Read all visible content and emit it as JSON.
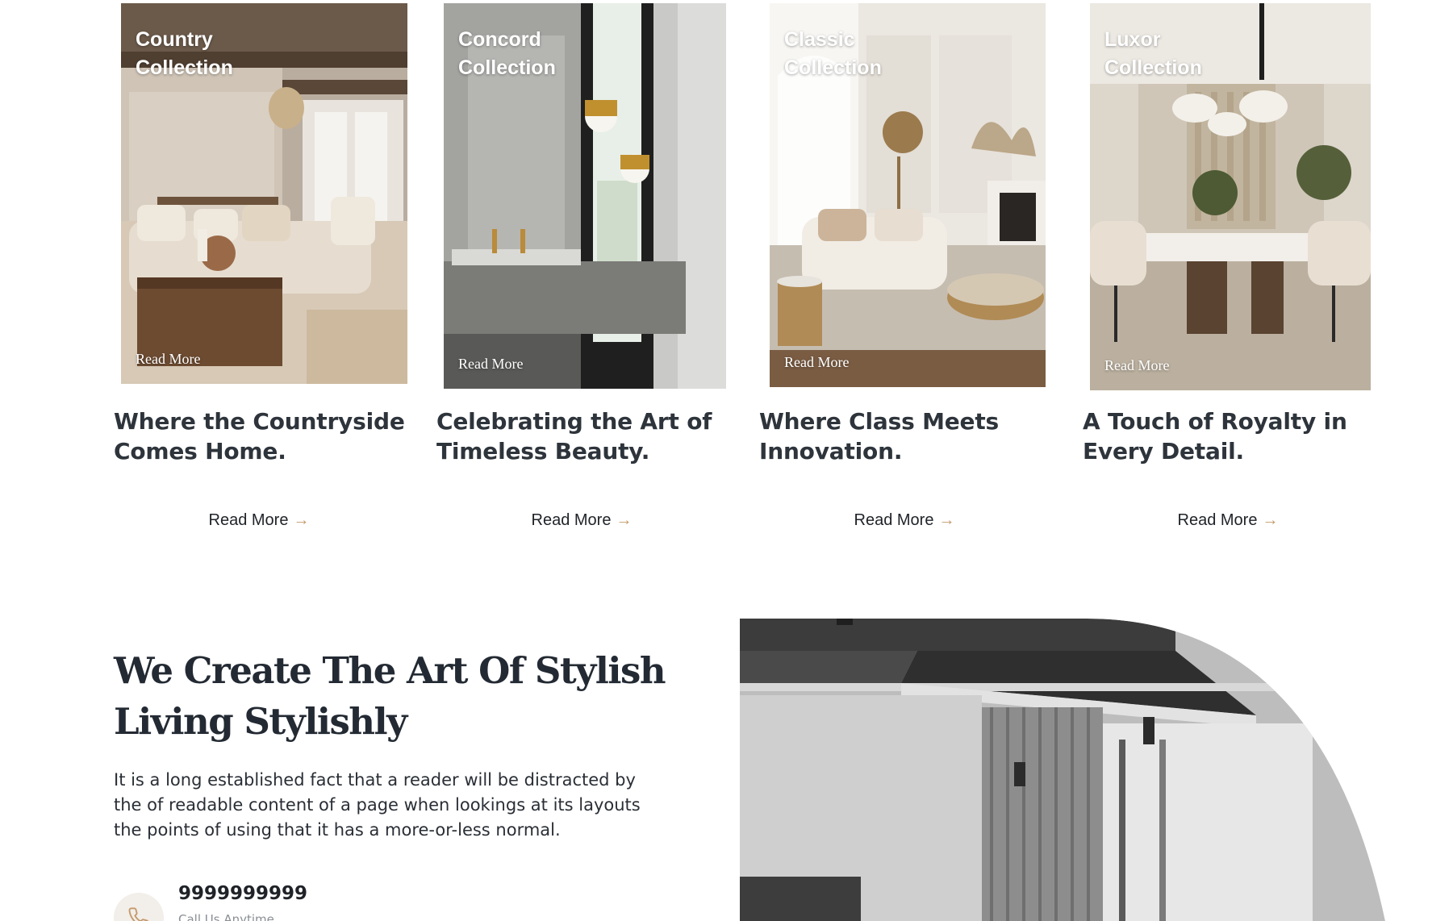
{
  "cards": [
    {
      "collection": "Country Collection",
      "image_link": "Read More",
      "title": "Where the Countryside Comes Home.",
      "read_more": "Read More"
    },
    {
      "collection": "Concord Collection",
      "image_link": "Read More",
      "title": "Celebrating the Art of Timeless Beauty.",
      "read_more": "Read More"
    },
    {
      "collection": "Classic Collection",
      "image_link": "Read More",
      "title": "Where Class Meets Innovation.",
      "read_more": "Read More"
    },
    {
      "collection": "Luxor Collection",
      "image_link": "Read More",
      "title": "A Touch of Royalty in Every Detail.",
      "read_more": "Read More"
    }
  ],
  "arrow_icon": "arrow-right-icon",
  "art_section": {
    "title": "We Create The Art Of Stylish Living Stylishly",
    "description": "It is a long established fact that a reader will be distracted by the of readable content of a page when lookings at its layouts the points of using that it has a more-or-less normal.",
    "phone_icon": "phone-icon",
    "phone_number": "9999999999",
    "phone_caption": "Call Us Anytime"
  },
  "colors": {
    "accent": "#c49a6c",
    "heading": "#2e343b",
    "text": "#2a2f36"
  }
}
